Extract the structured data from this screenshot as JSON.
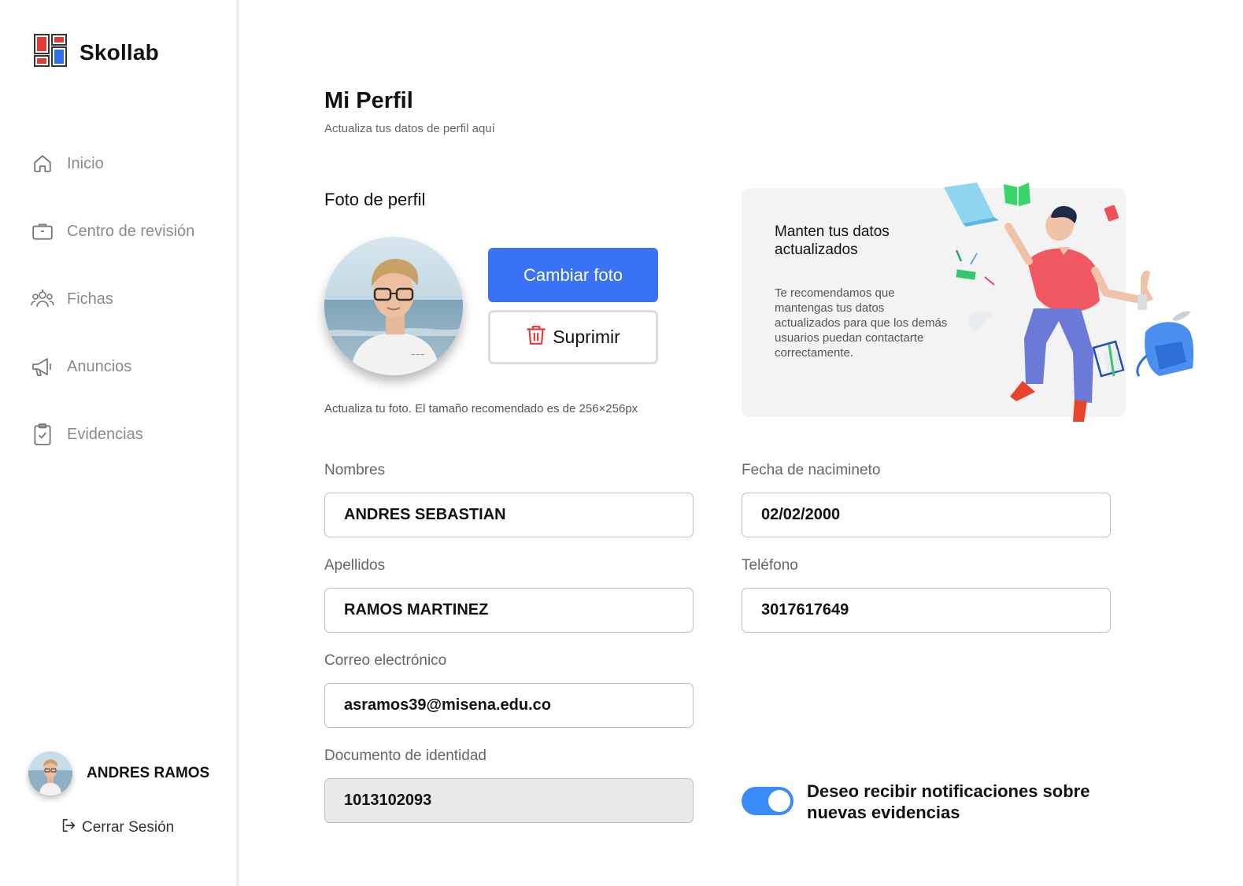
{
  "brand": {
    "name": "Skollab"
  },
  "sidebar": {
    "items": [
      {
        "label": "Inicio",
        "icon": "home-icon"
      },
      {
        "label": "Centro de revisión",
        "icon": "briefcase-icon"
      },
      {
        "label": "Fichas",
        "icon": "users-icon"
      },
      {
        "label": "Anuncios",
        "icon": "megaphone-icon"
      },
      {
        "label": "Evidencias",
        "icon": "clipboard-check-icon"
      }
    ],
    "user_name": "ANDRES RAMOS",
    "logout_label": "Cerrar Sesión"
  },
  "page": {
    "title": "Mi Perfil",
    "subtitle": "Actualiza tus datos de perfil aquí"
  },
  "photo_section": {
    "title": "Foto de perfil",
    "change_label": "Cambiar foto",
    "delete_label": "Suprimir",
    "hint": "Actualiza tu foto. El tamaño recomendado es de 256×256px"
  },
  "info_card": {
    "title": "Manten tus datos actualizados",
    "text": "Te recomendamos que mantengas tus datos actualizados para que los demás usuarios puedan contactarte correctamente."
  },
  "form": {
    "nombres": {
      "label": "Nombres",
      "value": "ANDRES SEBASTIAN"
    },
    "apellidos": {
      "label": "Apellidos",
      "value": "RAMOS MARTINEZ"
    },
    "correo": {
      "label": "Correo electrónico",
      "value": "asramos39@misena.edu.co"
    },
    "documento": {
      "label": "Documento de identidad",
      "value": "1013102093"
    },
    "fecha": {
      "label": "Fecha de nacimineto",
      "value": "02/02/2000"
    },
    "telefono": {
      "label": "Teléfono",
      "value": "3017617649"
    }
  },
  "notifications": {
    "label": "Deseo recibir notificaciones sobre nuevas evidencias",
    "enabled": true
  },
  "colors": {
    "primary": "#3a72f5",
    "toggle": "#3a8af7",
    "delete_icon": "#e53935"
  }
}
